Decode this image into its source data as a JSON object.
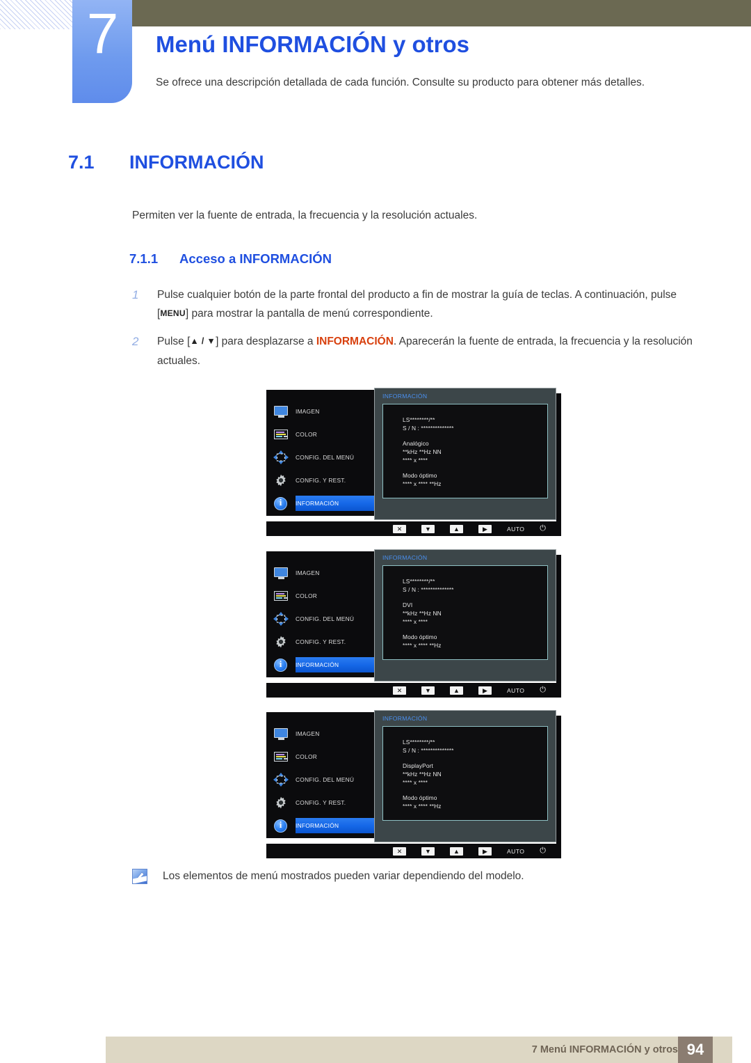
{
  "header": {
    "chapter_number": "7",
    "chapter_title": "Menú INFORMACIÓN y otros",
    "chapter_description": "Se ofrece una descripción detallada de cada función. Consulte su producto para obtener más detalles."
  },
  "section": {
    "number": "7.1",
    "title": "INFORMACIÓN",
    "intro": "Permiten ver la fuente de entrada, la frecuencia y la resolución actuales.",
    "subsection_number": "7.1.1",
    "subsection_title": "Acceso a INFORMACIÓN"
  },
  "steps": [
    {
      "number": "1",
      "part1": "Pulse cualquier botón de la parte frontal del producto a fin de mostrar la guía de teclas. A continuación, pulse [",
      "key": "MENU",
      "part2": "] para mostrar la pantalla de menú correspondiente."
    },
    {
      "number": "2",
      "part1": "Pulse [",
      "key": "▲ / ▼",
      "part2": "] para desplazarse a ",
      "highlight": "INFORMACIÓN",
      "part3": ". Aparecerán la fuente de entrada, la frecuencia y la resolución actuales."
    }
  ],
  "osd": {
    "menu_items": [
      {
        "icon": "monitor-icon",
        "label": "IMAGEN",
        "active": false
      },
      {
        "icon": "color-bars-icon",
        "label": "COLOR",
        "active": false
      },
      {
        "icon": "four-arrows-icon",
        "label": "CONFIG. DEL MENÚ",
        "active": false
      },
      {
        "icon": "gear-icon",
        "label": "CONFIG. Y REST.",
        "active": false
      },
      {
        "icon": "info-circle-icon",
        "label": "INFORMACIÓN",
        "active": true
      }
    ],
    "panel_title": "INFORMACIÓN",
    "model_line": "LS********/**",
    "serial_line": "S / N : **************",
    "frequency_line": "**kHz **Hz NN",
    "resolution_line": "**** x ****",
    "optimal_label": "Modo óptimo",
    "optimal_value": "**** x **** **Hz",
    "buttons": {
      "close": "✕",
      "down": "▼",
      "up": "▲",
      "enter": "▶",
      "auto": "AUTO",
      "power": "⏻"
    },
    "screens": [
      {
        "source": "Analógico"
      },
      {
        "source": "DVI"
      },
      {
        "source": "DisplayPort"
      }
    ]
  },
  "note": {
    "icon": "note-pen-icon",
    "text": "Los elementos de menú mostrados pueden variar dependiendo del modelo."
  },
  "footer": {
    "text": "7 Menú INFORMACIÓN y otros",
    "page": "94"
  },
  "colors": {
    "accent_blue": "#1f4fe0",
    "highlight_orange": "#d8400e",
    "olive_bar": "#6b6952",
    "footer_bar": "#ddd7c4",
    "footer_page_box": "#8b7d71",
    "osd_selected": "#1668e8"
  }
}
